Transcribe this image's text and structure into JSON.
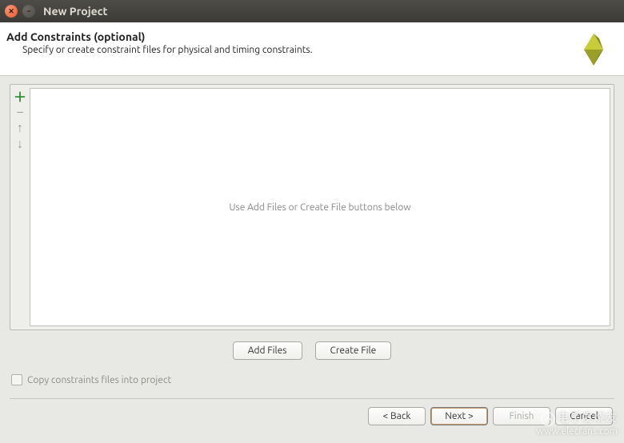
{
  "window": {
    "title": "New Project"
  },
  "header": {
    "heading": "Add Constraints (optional)",
    "description": "Specify or create constraint files for physical and timing constraints."
  },
  "file_area": {
    "placeholder": "Use Add Files or Create File buttons below"
  },
  "buttons": {
    "add_files": "Add Files",
    "create_file": "Create File"
  },
  "checkbox": {
    "copy_constraints": "Copy constraints files into project",
    "checked": false
  },
  "footer": {
    "back": "< Back",
    "next": "Next >",
    "finish": "Finish",
    "cancel": "Cancel"
  },
  "watermark": {
    "line1": "电子发烧友",
    "line2": "www.elecfans.com"
  }
}
